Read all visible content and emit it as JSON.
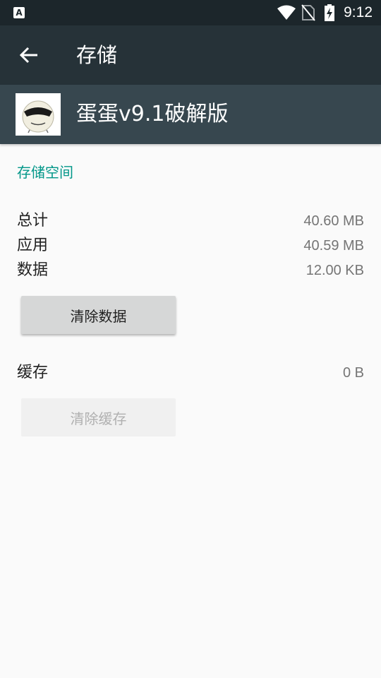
{
  "status_bar": {
    "notification_letter": "A",
    "time": "9:12",
    "icons": [
      "wifi-icon",
      "no-sim-icon",
      "battery-charging-icon"
    ]
  },
  "app_bar": {
    "back_icon": "arrow-back-icon",
    "title": "存储"
  },
  "app_header": {
    "icon": "egg-app-icon",
    "name": "蛋蛋v9.1破解版"
  },
  "storage": {
    "section_title": "存储空间",
    "rows": [
      {
        "label": "总计",
        "value": "40.60 MB"
      },
      {
        "label": "应用",
        "value": "40.59 MB"
      },
      {
        "label": "数据",
        "value": "12.00 KB"
      }
    ],
    "clear_data_label": "清除数据"
  },
  "cache": {
    "label": "缓存",
    "value": "0 B",
    "clear_cache_label": "清除缓存",
    "clear_cache_enabled": false
  },
  "colors": {
    "status_bar": "#1c262b",
    "app_bar": "#263238",
    "app_header": "#37474f",
    "accent": "#009688",
    "background": "#fafafa"
  }
}
